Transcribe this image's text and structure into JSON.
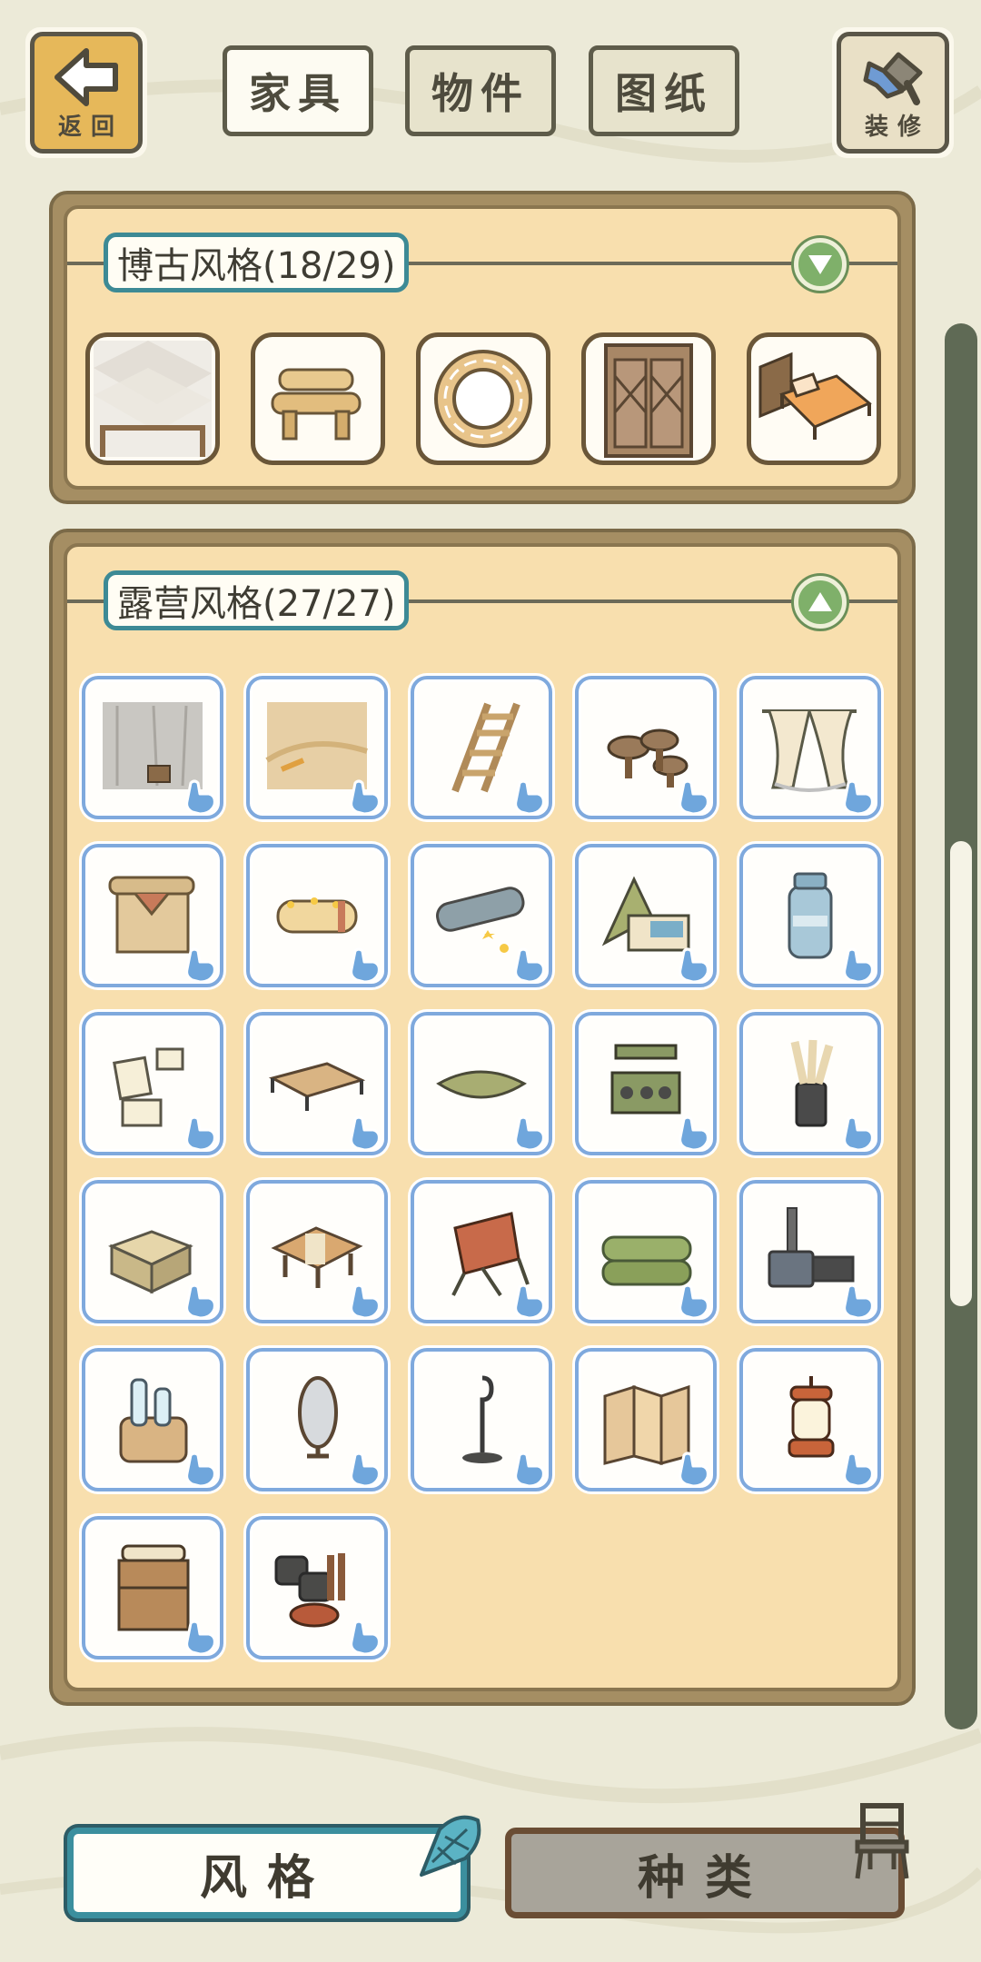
{
  "top_bar": {
    "back_label": "返回",
    "decorate_label": "装修",
    "tabs": [
      {
        "label": "家具",
        "active": true
      },
      {
        "label": "物件",
        "active": false
      },
      {
        "label": "图纸",
        "active": false
      }
    ]
  },
  "sections": [
    {
      "title": "博古风格(18/29)",
      "expanded": false,
      "toggle_icon": "chevron-down-icon",
      "items": [
        "tile-floor",
        "log-bench",
        "round-rug",
        "lattice-door",
        "orange-bed"
      ]
    },
    {
      "title": "露营风格(27/27)",
      "expanded": true,
      "toggle_icon": "chevron-up-icon",
      "items": [
        "stone-wall",
        "sand-floor",
        "wooden-ladder",
        "mushroom-stools",
        "tent-curtain",
        "canvas-tent-flap",
        "rolled-bedroll",
        "star-sleeping-bag",
        "pop-up-tent",
        "camp-thermos",
        "paper-notes",
        "low-camp-table",
        "folded-cushion",
        "camp-shelf",
        "scroll-holder",
        "cooler-box",
        "picnic-table",
        "camp-chair",
        "green-mats",
        "camp-stove",
        "drink-bucket",
        "oval-mirror",
        "lantern-hook",
        "folding-screen",
        "oil-lantern",
        "wood-cabinet",
        "cookware-pile"
      ]
    }
  ],
  "bottom_tabs": [
    {
      "label": "风格",
      "active": true,
      "icon": "shell-icon"
    },
    {
      "label": "种类",
      "active": false,
      "icon": "chair-icon"
    }
  ],
  "colors": {
    "background": "#ecead8",
    "panel_frame": "#a58e63",
    "panel_fill": "#f8dfae",
    "cell_border": "#7fa9dd",
    "title_border": "#3d8a95",
    "toggle_green": "#7fb06a"
  }
}
